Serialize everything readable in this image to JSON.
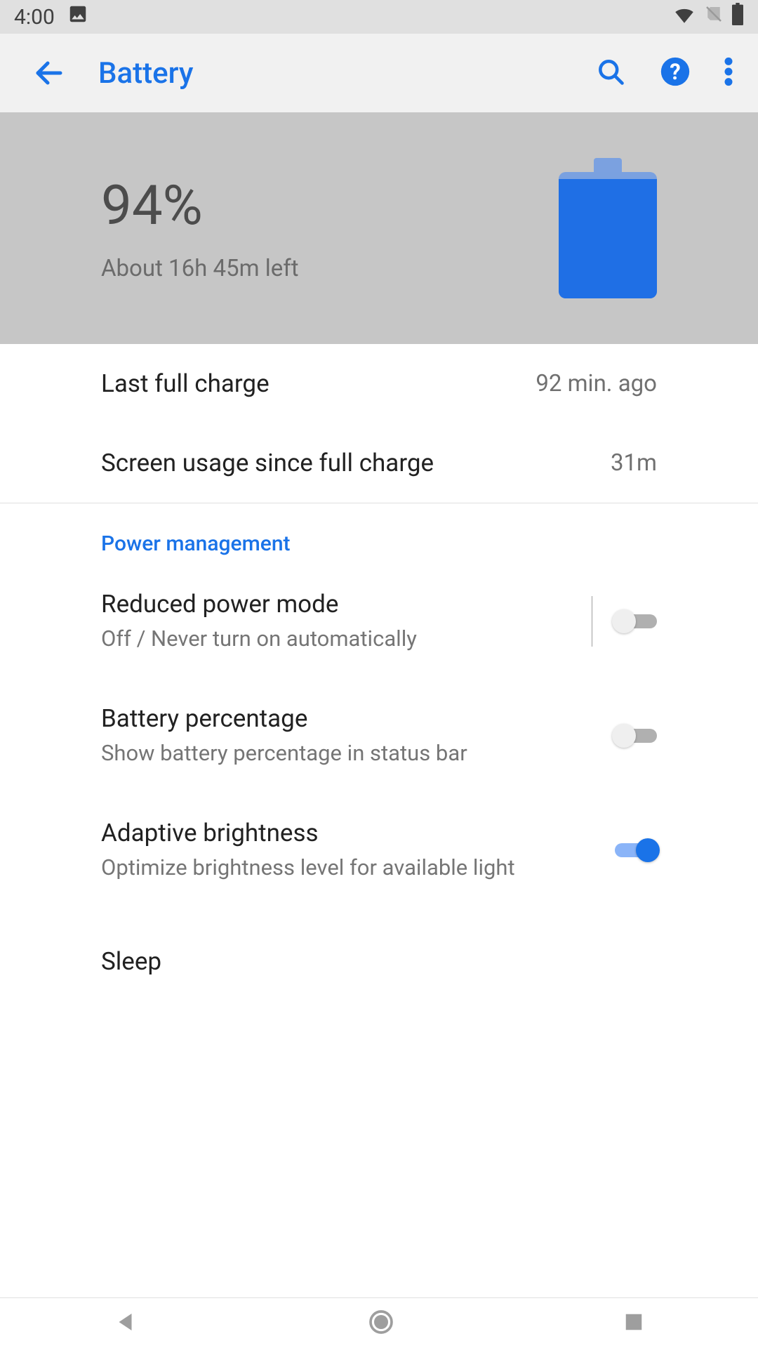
{
  "status_bar": {
    "time": "4:00"
  },
  "app_bar": {
    "title": "Battery"
  },
  "hero": {
    "percentage": "94%",
    "estimate": "About 16h 45m left"
  },
  "stats": {
    "last_full_charge": {
      "label": "Last full charge",
      "value": "92 min. ago"
    },
    "screen_usage": {
      "label": "Screen usage since full charge",
      "value": "31m"
    }
  },
  "power_mgmt": {
    "header": "Power management",
    "reduced_power": {
      "title": "Reduced power mode",
      "sub": "Off / Never turn on automatically",
      "on": false
    },
    "battery_pct": {
      "title": "Battery percentage",
      "sub": "Show battery percentage in status bar",
      "on": false
    },
    "adaptive_brightness": {
      "title": "Adaptive brightness",
      "sub": "Optimize brightness level for available light",
      "on": true
    },
    "sleep": {
      "title": "Sleep"
    }
  }
}
